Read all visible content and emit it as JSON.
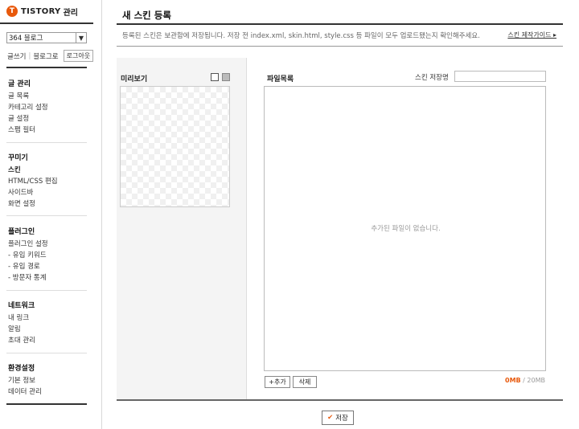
{
  "brand": {
    "logo_letter": "T",
    "name": "TISTORY",
    "sub": "관리"
  },
  "blog_select": {
    "value": "364 블로그"
  },
  "user_links": {
    "write": "글쓰기",
    "go_blog": "블로그로",
    "logout": "로그아웃"
  },
  "menu": [
    {
      "heading": "글 관리",
      "items": [
        {
          "label": "글 목록"
        },
        {
          "label": "카테고리 설정"
        },
        {
          "label": "글 설정"
        },
        {
          "label": "스팸 필터"
        }
      ]
    },
    {
      "heading": "꾸미기",
      "items": [
        {
          "label": "스킨",
          "active": true
        },
        {
          "label": "HTML/CSS 편집"
        },
        {
          "label": "사이드바"
        },
        {
          "label": "화면 설정"
        }
      ]
    },
    {
      "heading": "플러그인",
      "items": [
        {
          "label": "플러그인 설정"
        },
        {
          "label": "- 유입 키워드"
        },
        {
          "label": "- 유입 경로"
        },
        {
          "label": "- 방문자 통계"
        }
      ]
    },
    {
      "heading": "네트워크",
      "items": [
        {
          "label": "내 링크"
        },
        {
          "label": "알림"
        },
        {
          "label": "초대 관리"
        }
      ]
    },
    {
      "heading": "환경설정",
      "items": [
        {
          "label": "기본 정보"
        },
        {
          "label": "데이터 관리"
        }
      ]
    }
  ],
  "main": {
    "title": "새 스킨 등록",
    "notice": "등록된 스킨은 보관함에 저장됩니다. 저장 전 index.xml, skin.html, style.css 등 파일이 모두 업로드됐는지 확인해주세요.",
    "guide_link": "스킨 제작가이드 ▸",
    "preview_title": "미리보기",
    "files_title": "파일목록",
    "skin_name_label": "스킨 저장명",
    "skin_name_value": "",
    "files_empty": "추가된 파일이 없습니다.",
    "add_label": "+추가",
    "delete_label": "삭제",
    "usage_used": "0MB",
    "usage_sep": " / ",
    "usage_total": "20MB",
    "save_label": "저장"
  },
  "colors": {
    "accent": "#e8590c",
    "border_dark": "#333333",
    "panel_bg": "#f4f4f4"
  },
  "icons": {
    "preview_toggle_blank": "square-outline-icon",
    "preview_toggle_grid": "square-filled-icon",
    "save": "check-icon"
  }
}
